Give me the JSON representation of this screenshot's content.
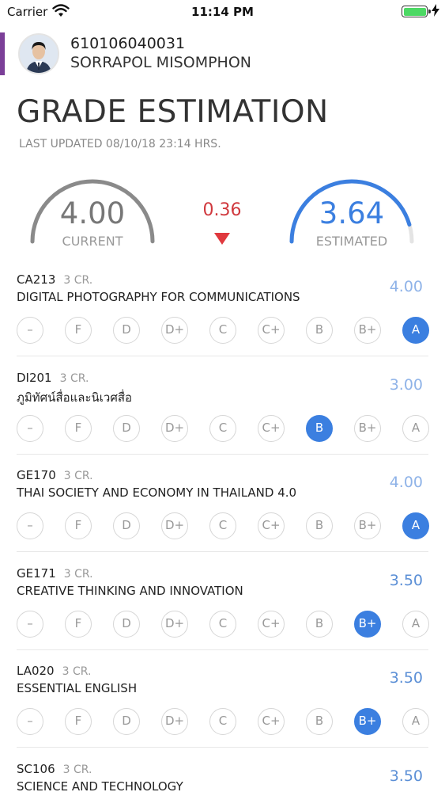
{
  "status_bar": {
    "carrier": "Carrier",
    "time": "11:14 PM",
    "battery_color": "#4cd964"
  },
  "profile": {
    "student_id": "610106040031",
    "student_name": "SORRAPOL MISOMPHON",
    "accent_color": "#7b3f98"
  },
  "page": {
    "title": "GRADE ESTIMATION",
    "last_updated": "LAST UPDATED 08/10/18 23:14 HRS."
  },
  "summary": {
    "current_value": "4.00",
    "current_label": "CURRENT",
    "current_fraction": 1.0,
    "estimated_value": "3.64",
    "estimated_label": "ESTIMATED",
    "estimated_fraction": 0.91,
    "difference": "0.36",
    "difference_direction": "down",
    "difference_color": "#d0393e",
    "estimated_color": "#3b7fe0",
    "current_color": "#8a8a8a"
  },
  "grade_options": [
    "–",
    "F",
    "D",
    "D+",
    "C",
    "C+",
    "B",
    "B+",
    "A"
  ],
  "courses": [
    {
      "code": "CA213",
      "credits": "3 CR.",
      "name": "DIGITAL PHOTOGRAPHY FOR COMMUNICATIONS",
      "grade_value": "4.00",
      "selected": "A"
    },
    {
      "code": "DI201",
      "credits": "3 CR.",
      "name": "ภูมิทัศน์สื่อและนิเวศสื่อ",
      "grade_value": "3.00",
      "selected": "B"
    },
    {
      "code": "GE170",
      "credits": "3 CR.",
      "name": "THAI SOCIETY AND ECONOMY IN THAILAND 4.0",
      "grade_value": "4.00",
      "selected": "A"
    },
    {
      "code": "GE171",
      "credits": "3 CR.",
      "name": "CREATIVE THINKING AND INNOVATION",
      "grade_value": "3.50",
      "selected": "B+"
    },
    {
      "code": "LA020",
      "credits": "3 CR.",
      "name": "ESSENTIAL ENGLISH",
      "grade_value": "3.50",
      "selected": "B+"
    },
    {
      "code": "SC106",
      "credits": "3 CR.",
      "name": "SCIENCE AND TECHNOLOGY",
      "grade_value": "3.50",
      "selected": ""
    }
  ],
  "colors": {
    "grade_value_light": "#8fb3e8",
    "grade_value_dark": "#5b8fd6",
    "selected_grade": "#3b7fe0"
  }
}
